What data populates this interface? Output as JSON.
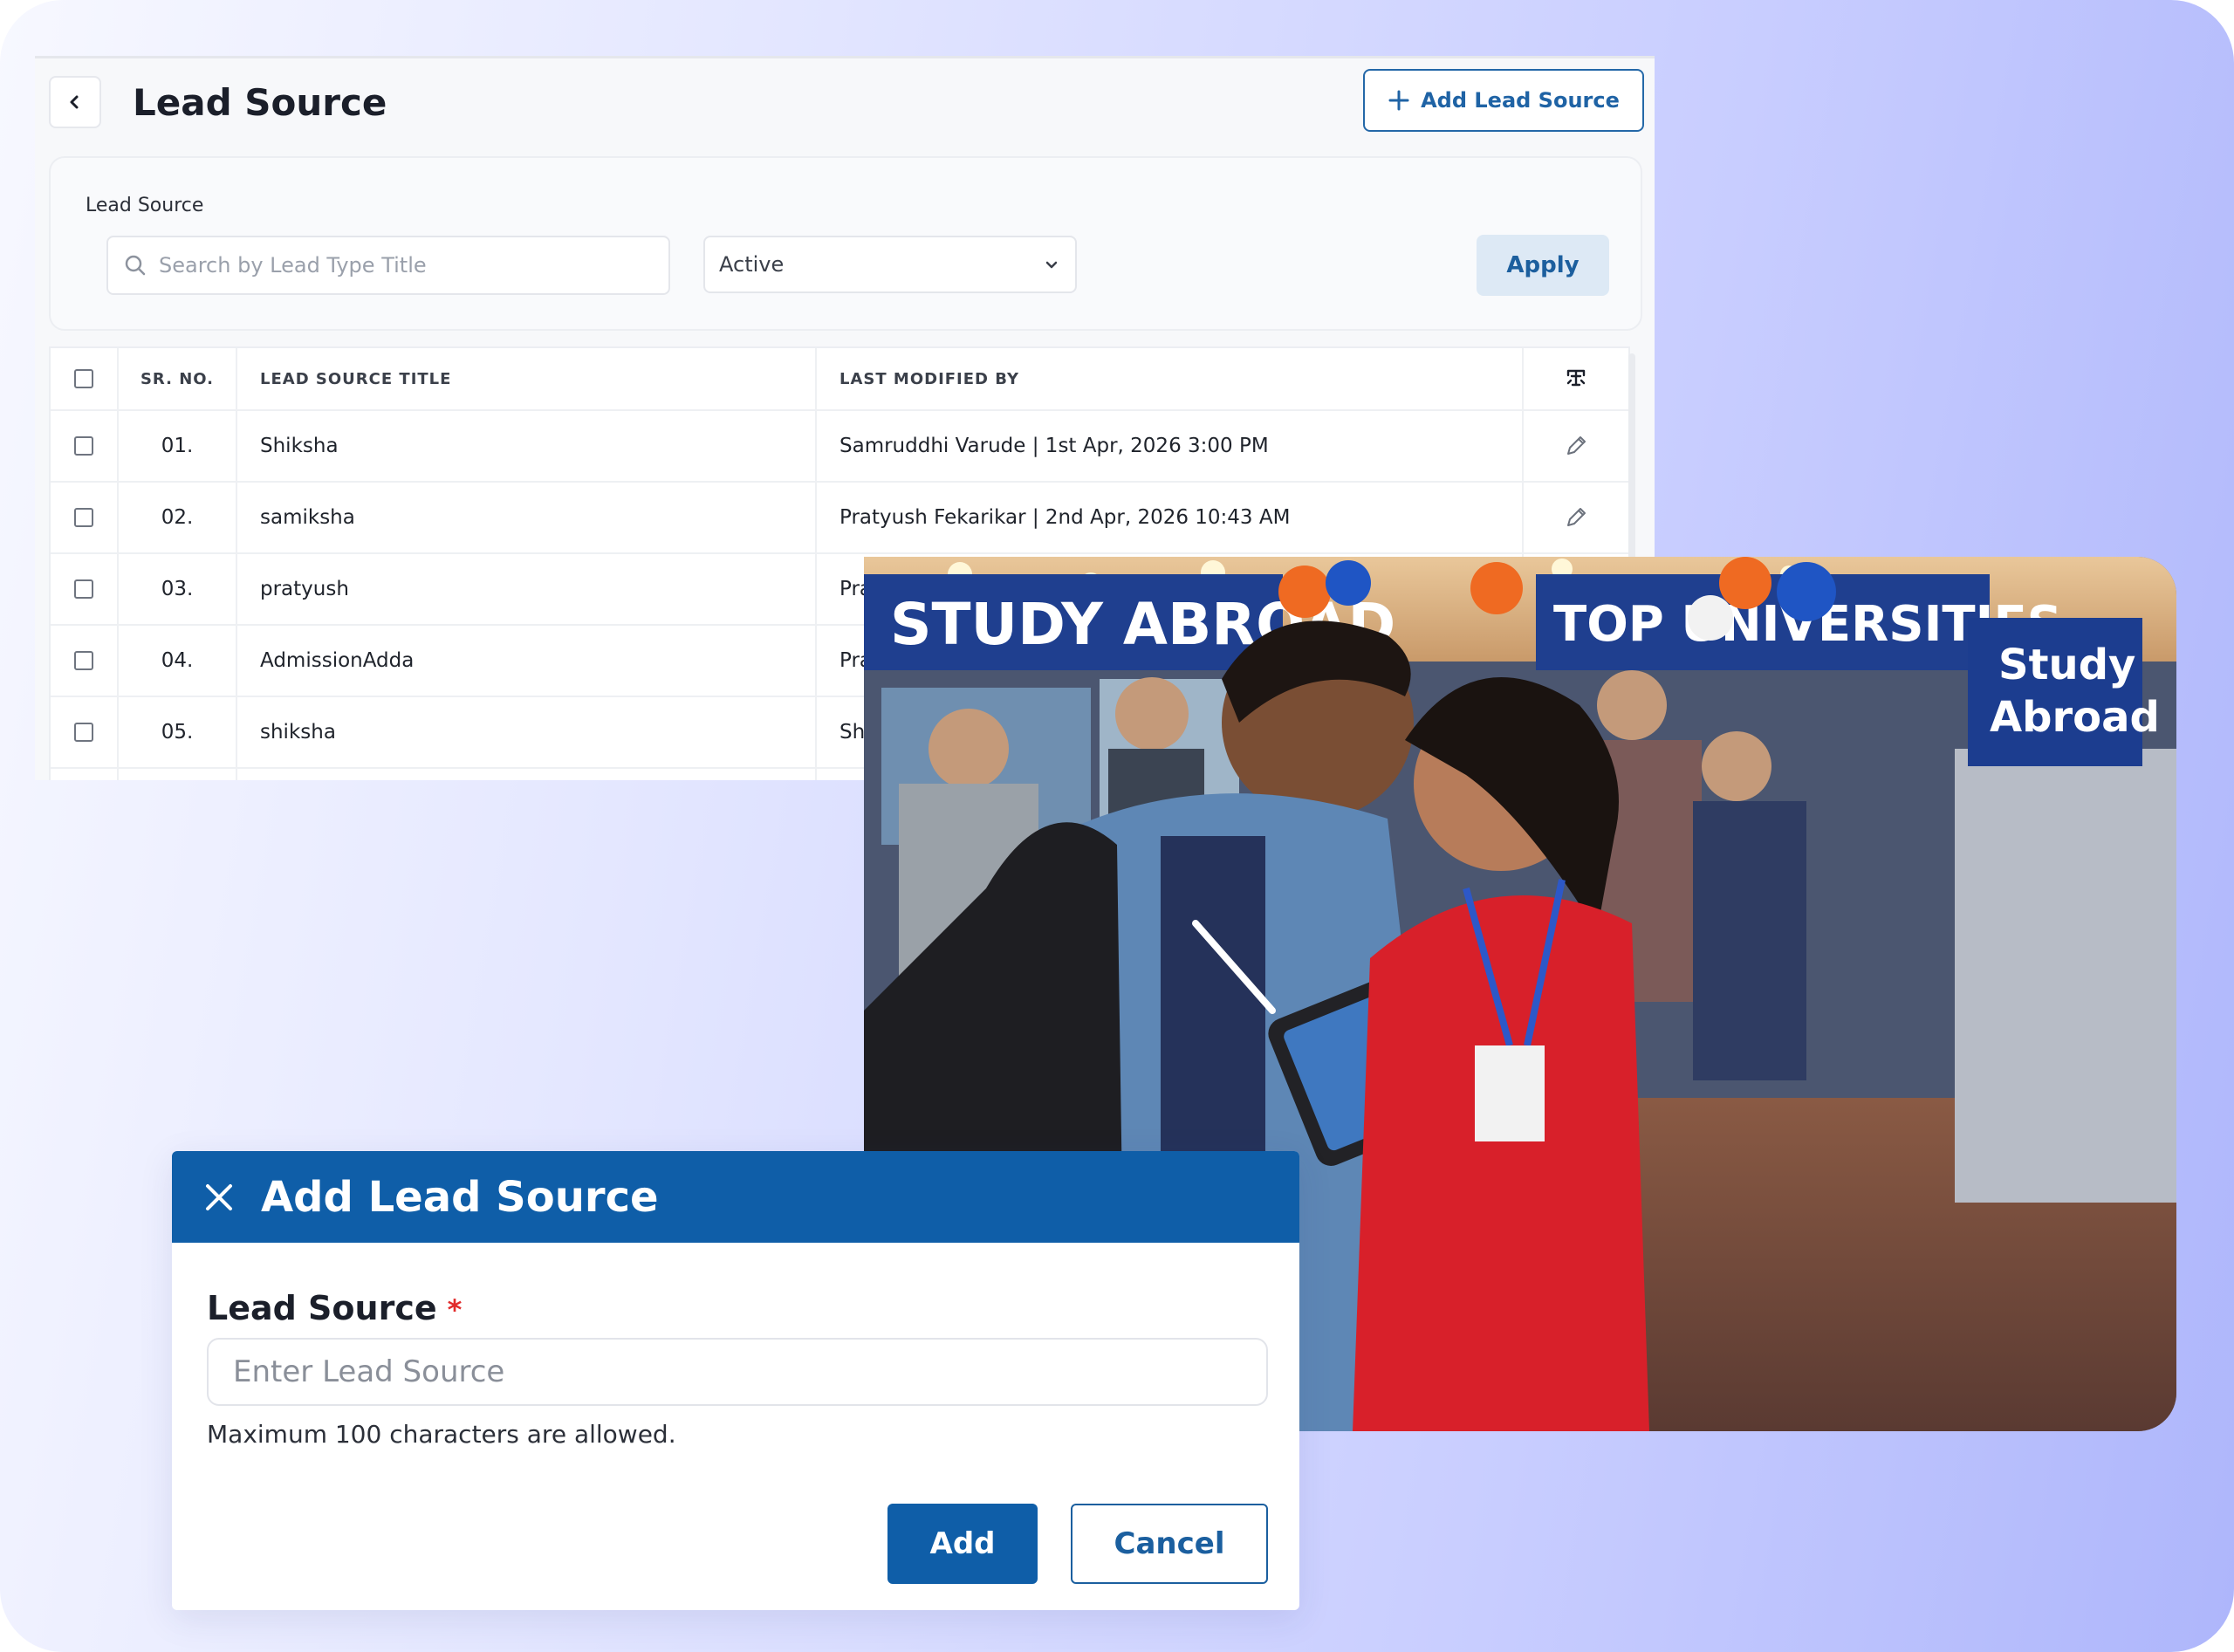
{
  "page": {
    "title": "Lead Source",
    "add_button_label": "Add Lead Source"
  },
  "filters": {
    "label": "Lead Source",
    "search_placeholder": "Search by Lead Type Title",
    "status_selected": "Active",
    "apply_label": "Apply"
  },
  "table": {
    "columns": [
      "SR. NO.",
      "LEAD SOURCE TITLE",
      "LAST MODIFIED BY"
    ],
    "rows": [
      {
        "sr": "01.",
        "title": "Shiksha",
        "modified": "Samruddhi Varude | 1st Apr, 2026 3:00 PM"
      },
      {
        "sr": "02.",
        "title": "samiksha",
        "modified": "Pratyush Fekarikar | 2nd Apr, 2026 10:43 AM"
      },
      {
        "sr": "03.",
        "title": "pratyush",
        "modified": "Pra"
      },
      {
        "sr": "04.",
        "title": "AdmissionAdda",
        "modified": "Pra"
      },
      {
        "sr": "05.",
        "title": "shiksha",
        "modified": "Sh"
      }
    ]
  },
  "photo": {
    "banner_left": "STUDY ABROAD",
    "banner_right": "TOP UNIVERSITIES",
    "sign_line1": "Study",
    "sign_line2": "Abroad"
  },
  "dialog": {
    "title": "Add Lead Source",
    "field_label": "Lead Source",
    "required_mark": "*",
    "placeholder": "Enter Lead Source",
    "hint": "Maximum 100 characters are allowed.",
    "add_label": "Add",
    "cancel_label": "Cancel"
  },
  "colors": {
    "primary": "#0f5ea8",
    "required": "#e12b2b",
    "apply_bg": "#dde9f5"
  }
}
